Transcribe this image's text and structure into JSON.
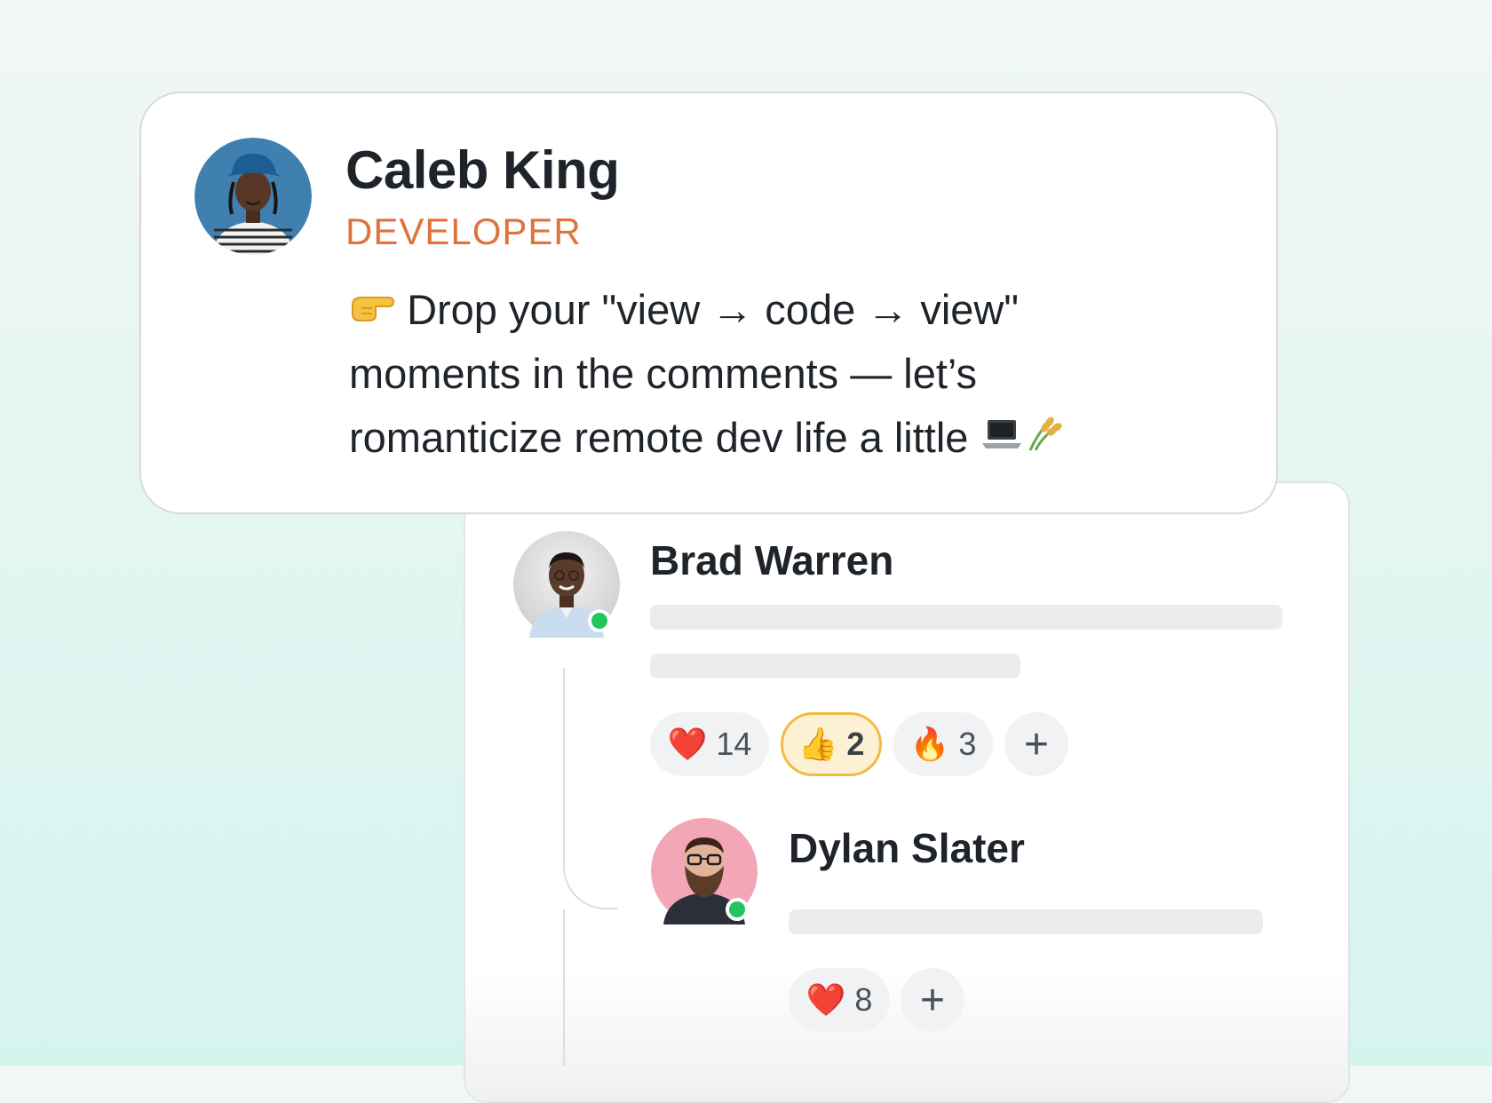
{
  "post": {
    "author": {
      "name": "Caleb King",
      "role": "DEVELOPER"
    },
    "text_line_1": "Drop your \"view → code → view\"",
    "text_line_2": "moments in the comments — let’s",
    "text_line_3": "romanticize remote dev life a little",
    "icons": {
      "lead": "pointing-right-hand-icon",
      "trail_1": "laptop-icon",
      "trail_2": "rice-sheaf-icon"
    }
  },
  "comments": [
    {
      "name": "Brad Warren",
      "online": true,
      "reactions": [
        {
          "emoji": "❤️",
          "icon": "heart-icon",
          "count": "14",
          "active": false
        },
        {
          "emoji": "👍",
          "icon": "thumbs-up-icon",
          "count": "2",
          "active": true
        },
        {
          "emoji": "🔥",
          "icon": "fire-icon",
          "count": "3",
          "active": false
        }
      ],
      "add_reaction": "+"
    },
    {
      "name": "Dylan Slater",
      "online": true,
      "reactions": [
        {
          "emoji": "❤️",
          "icon": "heart-icon",
          "count": "8",
          "active": false
        }
      ],
      "add_reaction": "+"
    }
  ],
  "colors": {
    "role": "#e0733b",
    "online": "#22c55e",
    "active_reaction_bg": "#fdf1d3",
    "active_reaction_border": "#f2bb43",
    "background_top": "#f1f7f5",
    "background_bottom": "#d6f4ee"
  }
}
